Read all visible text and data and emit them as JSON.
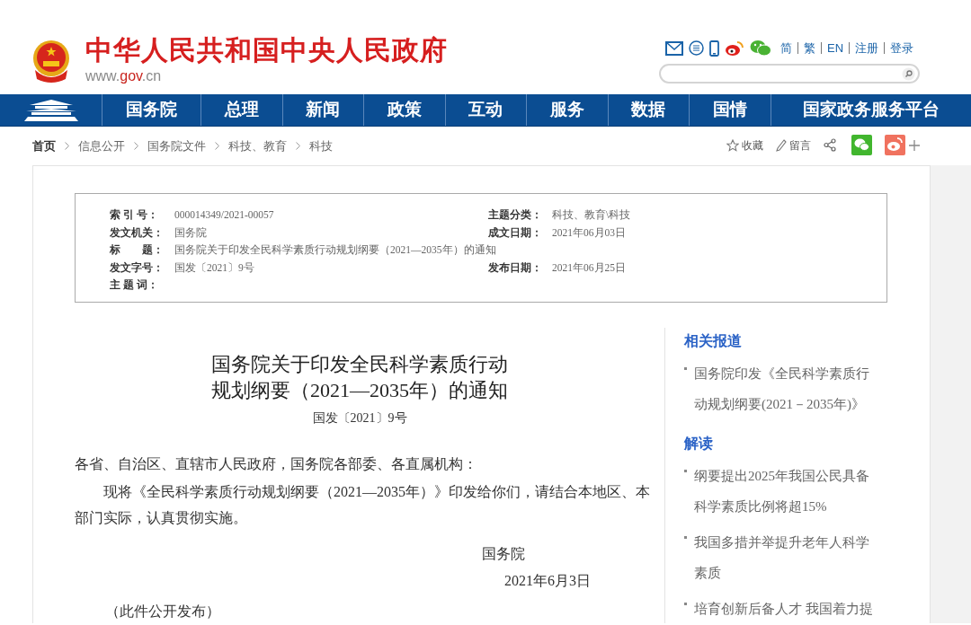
{
  "header": {
    "title": "中华人民共和国中央人民政府",
    "url_parts": [
      {
        "text": "www.",
        "kind": "plain"
      },
      {
        "text": "gov",
        "kind": "accent"
      },
      {
        "text": ".cn",
        "kind": "plain"
      }
    ],
    "links": [
      "简",
      "繁",
      "EN",
      "注册",
      "登录"
    ]
  },
  "nav": {
    "items": [
      "国务院",
      "总理",
      "新闻",
      "政策",
      "互动",
      "服务",
      "数据",
      "国情",
      "国家政务服务平台"
    ]
  },
  "breadcrumb": [
    {
      "label": "首页",
      "current": true
    },
    {
      "label": "信息公开",
      "current": false
    },
    {
      "label": "国务院文件",
      "current": false
    },
    {
      "label": "科技、教育",
      "current": false
    },
    {
      "label": "科技",
      "current": false
    }
  ],
  "page_actions": [
    "收藏",
    "留言"
  ],
  "info_table": {
    "rows": [
      {
        "label": "索 引 号：",
        "value": "000014349/2021-00057",
        "label_2": "主题分类：",
        "value_2": "科技、教育\\科技"
      },
      {
        "label": "发文机关：",
        "value": "国务院",
        "label_2": "成文日期：",
        "value_2": "2021年06月03日"
      },
      {
        "label": "标　　题：",
        "value": "国务院关于印发全民科学素质行动规划纲要（2021—2035年）的通知"
      },
      {
        "label": "发文字号：",
        "value": "国发〔2021〕9号",
        "label_2": "发布日期：",
        "value_2": "2021年06月25日"
      },
      {
        "label": "主 题 词：",
        "value": ""
      }
    ]
  },
  "article": {
    "title": "国务院关于印发全民科学素质行动规划纲要（2021—2035年）的通知",
    "doc_number": "国发〔2021〕9号",
    "salutation": "各省、自治区、直辖市人民政府，国务院各部委、各直属机构：",
    "body": "现将《全民科学素质行动规划纲要（2021—2035年）》印发给你们，请结合本地区、本部门实际，认真贯彻实施。",
    "signature": "国务院",
    "date": "2021年6月3日",
    "note": "（此件公开发布）"
  },
  "sidebar": {
    "sections": [
      {
        "heading": "相关报道",
        "items": [
          "国务院印发《全民科学素质行动规划纲要(2021－2035年)》"
        ]
      },
      {
        "heading": "解读",
        "items": [
          "纲要提出2025年我国公民具备科学素质比例将超15%",
          "我国多措并举提升老年人科学素质",
          "培育创新后备人才 我国着力提"
        ]
      }
    ]
  }
}
